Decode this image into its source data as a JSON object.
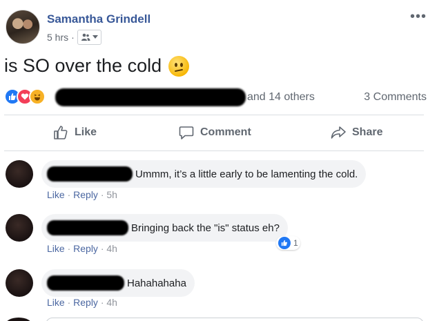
{
  "post": {
    "author": "Samantha Grindell",
    "time": "5 hrs",
    "audience_icon": "friends-icon",
    "status_text": "is SO over the cold",
    "status_emoji": "confused-face-icon",
    "reactions": {
      "icons": [
        "like-icon",
        "love-icon",
        "haha-icon"
      ],
      "others_text": "and 14 others",
      "comments_text": "3 Comments"
    },
    "actions": {
      "like": "Like",
      "comment": "Comment",
      "share": "Share"
    }
  },
  "comments": [
    {
      "text": "Ummm, it’s a little early to be lamenting the cold.",
      "like": "Like",
      "reply": "Reply",
      "time": "5h"
    },
    {
      "text": "Bringing back the \"is\" status eh?",
      "like": "Like",
      "reply": "Reply",
      "time": "4h",
      "reaction_count": "1"
    },
    {
      "text": "Hahahahaha",
      "like": "Like",
      "reply": "Reply",
      "time": "4h"
    }
  ],
  "colors": {
    "link": "#385898",
    "like_blue": "#2078f4",
    "love_red": "#f33e58",
    "haha_yellow": "#f7b125",
    "bubble_gray": "#f2f3f5",
    "muted_text": "#606770"
  }
}
